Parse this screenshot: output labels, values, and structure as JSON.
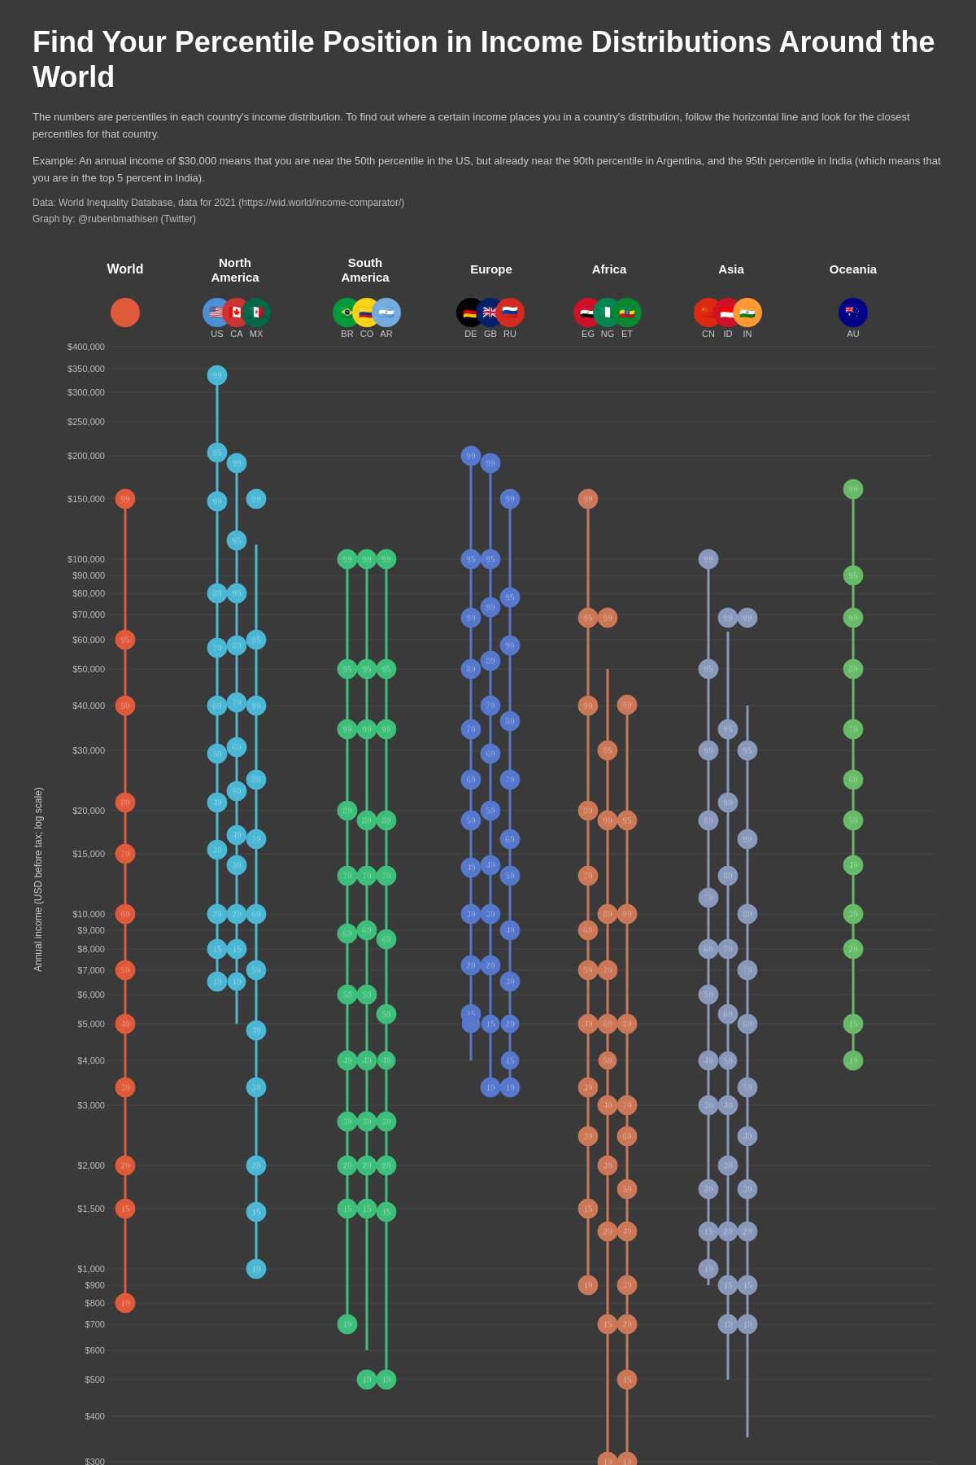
{
  "title": "Find Your Percentile Position in Income Distributions Around the World",
  "description1": "The numbers are percentiles in each country's income distribution. To find out where a certain income places you in a country's distribution, follow the horizontal line and look for the closest percentiles for that country.",
  "description2": "Example: An annual income of $30,000 means that you are near the 50th percentile in the US, but already near the 90th percentile in Argentina, and the 95th percentile in India (which means that you are in the top 5 percent in India).",
  "data_source": "Data: World Inequality Database, data for 2021 (https://wid.world/income-comparator/)",
  "graph_by": "Graph by: @rubenbmathisen (Twitter)",
  "y_axis_label": "Annual income (USD before tax; log scale)",
  "regions": [
    {
      "id": "world",
      "name": "World",
      "sub": "",
      "countries": [
        ""
      ],
      "colors": [
        "#e05a3a"
      ],
      "flag_emoji": [
        "🌍"
      ]
    },
    {
      "id": "north_america",
      "name": "North America",
      "sub": "",
      "countries": [
        "US",
        "CA",
        "MX"
      ],
      "colors": [
        "#4ab8d4",
        "#4ab8d4",
        "#4ab8d4"
      ],
      "flag_emoji": [
        "🇺🇸",
        "🇨🇦",
        "🇲🇽"
      ]
    },
    {
      "id": "south_america",
      "name": "South America",
      "sub": "",
      "countries": [
        "BR",
        "CO",
        "AR"
      ],
      "colors": [
        "#3dbf7a",
        "#3dbf7a",
        "#3dbf7a"
      ],
      "flag_emoji": [
        "🇧🇷",
        "🇨🇴",
        "🇦🇷"
      ]
    },
    {
      "id": "europe",
      "name": "Europe",
      "sub": "",
      "countries": [
        "DE",
        "GB",
        "RU"
      ],
      "colors": [
        "#5577cc",
        "#5577cc",
        "#5577cc"
      ],
      "flag_emoji": [
        "🇩🇪",
        "🇬🇧",
        "🇷🇺"
      ]
    },
    {
      "id": "africa",
      "name": "Africa",
      "sub": "",
      "countries": [
        "EG",
        "NG",
        "ET"
      ],
      "colors": [
        "#cc7755",
        "#cc7755",
        "#cc7755"
      ],
      "flag_emoji": [
        "🇪🇬",
        "🇳🇬",
        "🇪🇹"
      ]
    },
    {
      "id": "asia",
      "name": "Asia",
      "sub": "",
      "countries": [
        "CN",
        "ID",
        "IN"
      ],
      "colors": [
        "#8899bb",
        "#8899bb",
        "#8899bb"
      ],
      "flag_emoji": [
        "🇨🇳",
        "🇮🇩",
        "🇮🇳"
      ]
    },
    {
      "id": "oceania",
      "name": "Oceania",
      "sub": "",
      "countries": [
        "AU"
      ],
      "colors": [
        "#66bb66"
      ],
      "flag_emoji": [
        "🇦🇺"
      ]
    }
  ],
  "income_labels": [
    "$400,000",
    "$350,000",
    "$300,000",
    "$250,000",
    "$200,000",
    "$150,000",
    "$100,000",
    "$90,000",
    "$80,000",
    "$70,000",
    "$60,000",
    "$50,000",
    "$40,000",
    "$30,000",
    "$20,000",
    "$15,000",
    "$10,000",
    "$9,000",
    "$8,000",
    "$7,000",
    "$6,000",
    "$5,000",
    "$4,000",
    "$3,000",
    "$2,000",
    "$1,500",
    "$1,000",
    "$900",
    "$800",
    "$700",
    "$600",
    "$500",
    "$400",
    "$300"
  ]
}
